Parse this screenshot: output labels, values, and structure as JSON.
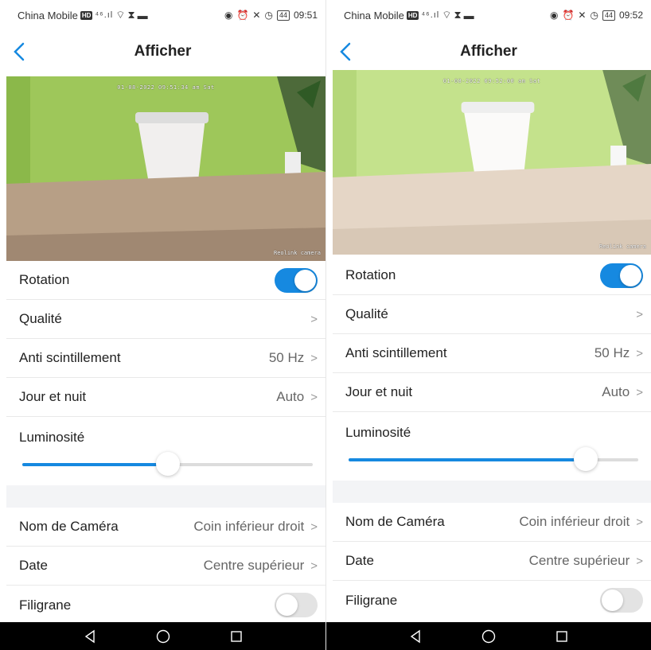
{
  "screens": [
    {
      "status": {
        "carrier": "China Mobile",
        "signal": "⁴⁶.ıl",
        "battery": "44",
        "time": "09:51"
      },
      "nav": {
        "title": "Afficher"
      },
      "preview": {
        "date_overlay": "01-08-2022 09:51:34 am Sat",
        "name_overlay": "Reolink camera"
      },
      "settings": {
        "rotation": {
          "label": "Rotation",
          "on": true
        },
        "quality": {
          "label": "Qualité"
        },
        "antiflicker": {
          "label": "Anti scintillement",
          "value": "50 Hz"
        },
        "daynight": {
          "label": "Jour et nuit",
          "value": "Auto"
        },
        "brightness": {
          "label": "Luminosité",
          "level": 0.5
        },
        "camera_name": {
          "label": "Nom de Caméra",
          "value": "Coin inférieur droit"
        },
        "date": {
          "label": "Date",
          "value": "Centre supérieur"
        },
        "watermark": {
          "label": "Filigrane",
          "on": false
        }
      }
    },
    {
      "status": {
        "carrier": "China Mobile",
        "signal": "⁴⁶.ıl",
        "battery": "44",
        "time": "09:52"
      },
      "nav": {
        "title": "Afficher"
      },
      "preview": {
        "date_overlay": "01-08-2022 09:52:00 am Sat",
        "name_overlay": "Reolink camera"
      },
      "settings": {
        "rotation": {
          "label": "Rotation",
          "on": true
        },
        "quality": {
          "label": "Qualité"
        },
        "antiflicker": {
          "label": "Anti scintillement",
          "value": "50 Hz"
        },
        "daynight": {
          "label": "Jour et nuit",
          "value": "Auto"
        },
        "brightness": {
          "label": "Luminosité",
          "level": 0.82
        },
        "camera_name": {
          "label": "Nom de Caméra",
          "value": "Coin inférieur droit"
        },
        "date": {
          "label": "Date",
          "value": "Centre supérieur"
        },
        "watermark": {
          "label": "Filigrane",
          "on": false
        }
      }
    }
  ],
  "colors": {
    "accent": "#1689e0",
    "toggle_off": "#e3e3e3",
    "wall_left": "#a6cf5e",
    "wall_right": "#c2e089"
  },
  "system_nav": {
    "back": "back-icon",
    "home": "home-icon",
    "recents": "recents-icon"
  }
}
